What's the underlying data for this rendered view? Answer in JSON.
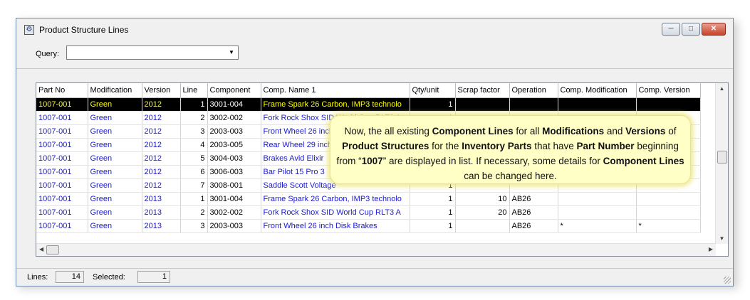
{
  "window": {
    "title": "Product Structure Lines"
  },
  "query": {
    "label": "Query:",
    "value": ""
  },
  "grid": {
    "columns": [
      "Part No",
      "Modification",
      "Version",
      "Line",
      "Component",
      "Comp. Name 1",
      "Qty/unit",
      "Scrap factor",
      "Operation",
      "Comp. Modification",
      "Comp. Version"
    ],
    "rows": [
      {
        "part_no": "1007-001",
        "modification": "Green",
        "version": "2012",
        "line": "1",
        "component": "3001-004",
        "comp_name": "Frame Spark 26 Carbon, IMP3 technolo",
        "qty": "1",
        "scrap": "",
        "operation": "",
        "comp_mod": "",
        "comp_ver": ""
      },
      {
        "part_no": "1007-001",
        "modification": "Green",
        "version": "2012",
        "line": "2",
        "component": "3002-002",
        "comp_name": "Fork Rock Shox SID World Cup RLT3 A",
        "qty": "1",
        "scrap": "",
        "operation": "",
        "comp_mod": "",
        "comp_ver": ""
      },
      {
        "part_no": "1007-001",
        "modification": "Green",
        "version": "2012",
        "line": "3",
        "component": "2003-003",
        "comp_name": "Front Wheel 26 inch Disk Brakes",
        "qty": "",
        "scrap": "",
        "operation": "",
        "comp_mod": "",
        "comp_ver": ""
      },
      {
        "part_no": "1007-001",
        "modification": "Green",
        "version": "2012",
        "line": "4",
        "component": "2003-005",
        "comp_name": "Rear Wheel 29 inch",
        "qty": "",
        "scrap": "",
        "operation": "",
        "comp_mod": "",
        "comp_ver": ""
      },
      {
        "part_no": "1007-001",
        "modification": "Green",
        "version": "2012",
        "line": "5",
        "component": "3004-003",
        "comp_name": "Brakes Avid Elixir",
        "qty": "",
        "scrap": "",
        "operation": "",
        "comp_mod": "",
        "comp_ver": ""
      },
      {
        "part_no": "1007-001",
        "modification": "Green",
        "version": "2012",
        "line": "6",
        "component": "3006-003",
        "comp_name": "Bar Pilot 15 Pro 3",
        "qty": "",
        "scrap": "",
        "operation": "",
        "comp_mod": "",
        "comp_ver": ""
      },
      {
        "part_no": "1007-001",
        "modification": "Green",
        "version": "2012",
        "line": "7",
        "component": "3008-001",
        "comp_name": "Saddle Scott Voltage",
        "qty": "1",
        "scrap": "",
        "operation": "",
        "comp_mod": "",
        "comp_ver": ""
      },
      {
        "part_no": "1007-001",
        "modification": "Green",
        "version": "2013",
        "line": "1",
        "component": "3001-004",
        "comp_name": "Frame Spark 26 Carbon, IMP3 technolo",
        "qty": "1",
        "scrap": "10",
        "operation": "AB26",
        "comp_mod": "",
        "comp_ver": ""
      },
      {
        "part_no": "1007-001",
        "modification": "Green",
        "version": "2013",
        "line": "2",
        "component": "3002-002",
        "comp_name": "Fork Rock Shox SID World Cup RLT3 A",
        "qty": "1",
        "scrap": "20",
        "operation": "AB26",
        "comp_mod": "",
        "comp_ver": ""
      },
      {
        "part_no": "1007-001",
        "modification": "Green",
        "version": "2013",
        "line": "3",
        "component": "2003-003",
        "comp_name": "Front Wheel 26 inch Disk Brakes",
        "qty": "1",
        "scrap": "",
        "operation": "AB26",
        "comp_mod": "*",
        "comp_ver": "*"
      }
    ]
  },
  "status": {
    "lines_label": "Lines:",
    "lines_value": "14",
    "selected_label": "Selected:",
    "selected_value": "1"
  },
  "callout": {
    "t1": "Now, the all existing ",
    "b1": "Component Lines",
    "t2": " for all ",
    "b2": "Modifications",
    "t3": " and ",
    "b3": "Versions",
    "t4": " of ",
    "b4": "Product Structures",
    "t5": " for the ",
    "b5": "Inventory Parts",
    "t6": " that have ",
    "b6": "Part Number",
    "t7": " beginning from “",
    "b7": "1007",
    "t8": "” are displayed in list. If necessary, some details for ",
    "b8": "Component Lines",
    "t9": " can be changed here."
  },
  "colors": {
    "selected_row_bg": "#000000",
    "selected_row_text": "#ffff00",
    "row_text": "#1a1ad2",
    "callout_bg": "#ffffc6"
  },
  "icons": {
    "app": "product-structure-icon",
    "minimize": "minimize-icon",
    "maximize": "maximize-icon",
    "close": "close-icon"
  }
}
